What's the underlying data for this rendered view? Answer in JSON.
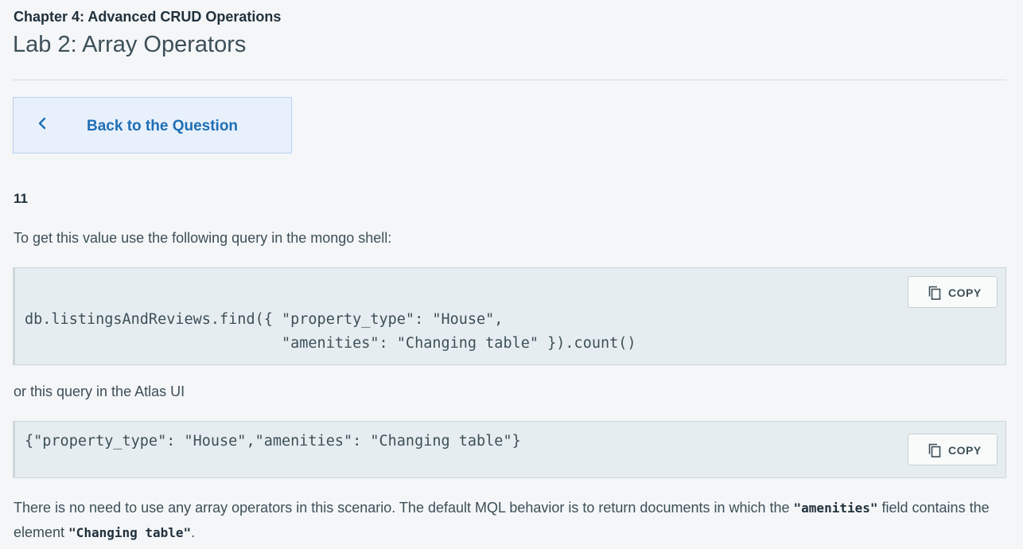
{
  "header": {
    "chapter": "Chapter 4: Advanced CRUD Operations",
    "lab_title": "Lab 2: Array Operators"
  },
  "back_button": {
    "label": "Back to the Question",
    "icon": "chevron-left-icon"
  },
  "answer": "11",
  "intro_text": "To get this value use the following query in the mongo shell:",
  "shell_query": {
    "line1": "db.listingsAndReviews.find({ \"property_type\": \"House\",",
    "line2": "                             \"amenities\": \"Changing table\" }).count()",
    "copy_label": "COPY"
  },
  "atlas_text": "or this query in the Atlas UI",
  "atlas_query": {
    "line1": "{\"property_type\": \"House\",\"amenities\": \"Changing table\"}",
    "copy_label": "COPY"
  },
  "explanation": {
    "part1": "There is no need to use any array operators in this scenario. The default MQL behavior is to return documents in which the ",
    "code1": "\"amenities\"",
    "part2": " field contains the element ",
    "code2": "\"Changing table\"",
    "part3": "."
  },
  "colors": {
    "link_blue": "#1d6fb6",
    "back_bg": "#e8f0fb",
    "code_bg": "#e6edf0"
  }
}
